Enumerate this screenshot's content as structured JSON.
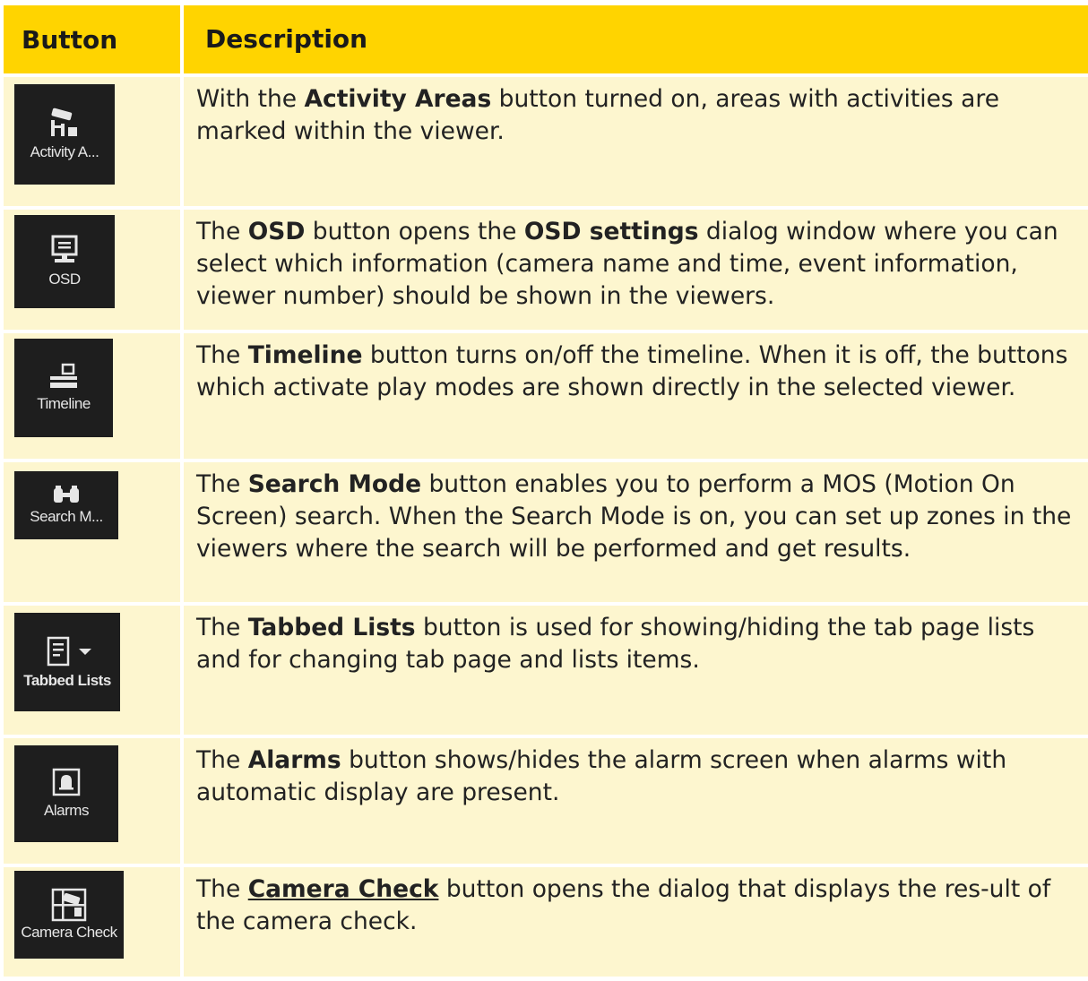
{
  "header": {
    "col1": "Button",
    "col2": "Description"
  },
  "rows": [
    {
      "icon": "activity-areas-icon",
      "button_label": "Activity A...",
      "pre": "With the ",
      "bold": "Activity Areas",
      "post": " button turned on, areas with activities are marked within the viewer."
    },
    {
      "icon": "osd-monitor-icon",
      "button_label": "OSD",
      "pre": "The ",
      "bold": "OSD",
      "mid": " button opens the ",
      "bold2": "OSD settings",
      "post": " dialog window where you can select which information (camera name and time, event information, viewer number) should be shown in the viewers."
    },
    {
      "icon": "timeline-icon",
      "button_label": "Timeline",
      "pre": "The ",
      "bold": "Timeline",
      "post": " button turns on/off the timeline. When it is off, the buttons which activate play modes are shown directly in the selected viewer."
    },
    {
      "icon": "binoculars-icon",
      "button_label": "Search M...",
      "pre": "The ",
      "bold": "Search Mode",
      "post": " button enables you to perform a MOS (Motion On Screen) search. When the Search Mode is on, you can set up zones in the viewers where the search will be performed and get results."
    },
    {
      "icon": "tabbed-lists-icon",
      "button_label": "Tabbed Lists",
      "pre": "The ",
      "bold": "Tabbed Lists",
      "post": " button is used for showing/hiding the tab page lists and for changing tab page and lists items."
    },
    {
      "icon": "alarm-bell-icon",
      "button_label": "Alarms",
      "pre": "The ",
      "bold": "Alarms",
      "post": " button shows/hides the alarm screen when alarms with automatic display are present."
    },
    {
      "icon": "camera-check-icon",
      "button_label": "Camera Check",
      "pre": "The ",
      "link": "Camera Check",
      "post": " button opens the dialog that displays the res-ult of the camera check."
    }
  ],
  "colors": {
    "header_bg": "#ffd400",
    "cell_bg": "#fdf6cf",
    "icon_bg": "#1e1e1e"
  }
}
